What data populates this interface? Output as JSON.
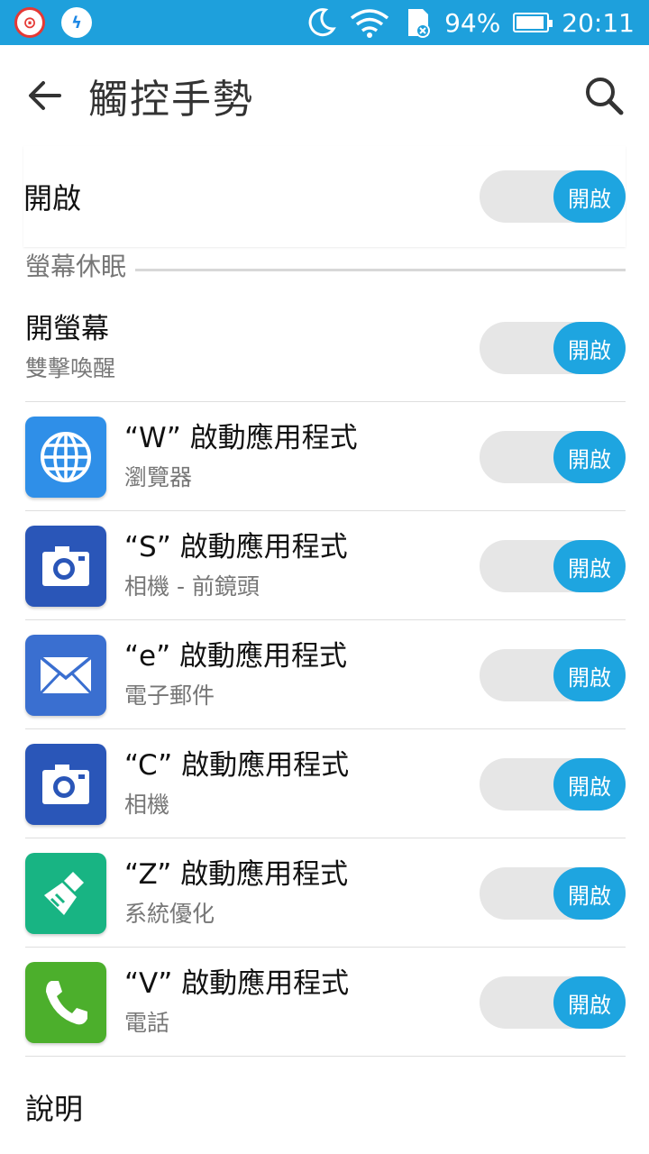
{
  "status_bar": {
    "battery": "94%",
    "battery_level": 0.94,
    "time": "20:11"
  },
  "app_bar": {
    "title": "觸控手勢"
  },
  "master": {
    "label": "開啟",
    "toggle": "開啟"
  },
  "section": {
    "title": "螢幕休眠"
  },
  "items": [
    {
      "title": "開螢幕",
      "subtitle": "雙擊喚醒",
      "toggle": "開啟",
      "icon": "none"
    },
    {
      "title": "“W” 啟動應用程式",
      "subtitle": "瀏覽器",
      "toggle": "開啟",
      "icon": "browser-globe-icon",
      "color": "#2f8fe8"
    },
    {
      "title": "“S” 啟動應用程式",
      "subtitle": "相機 - 前鏡頭",
      "toggle": "開啟",
      "icon": "camera-icon",
      "color": "#2a56b8"
    },
    {
      "title": "“e” 啟動應用程式",
      "subtitle": "電子郵件",
      "toggle": "開啟",
      "icon": "email-envelope-icon",
      "color": "#3a6fd0"
    },
    {
      "title": "“C” 啟動應用程式",
      "subtitle": "相機",
      "toggle": "開啟",
      "icon": "camera-icon",
      "color": "#2a56b8"
    },
    {
      "title": "“Z” 啟動應用程式",
      "subtitle": "系統優化",
      "toggle": "開啟",
      "icon": "broom-icon",
      "color": "#18b483"
    },
    {
      "title": "“V” 啟動應用程式",
      "subtitle": "電話",
      "toggle": "開啟",
      "icon": "phone-icon",
      "color": "#4caf2c"
    }
  ],
  "help": {
    "label": "說明"
  }
}
